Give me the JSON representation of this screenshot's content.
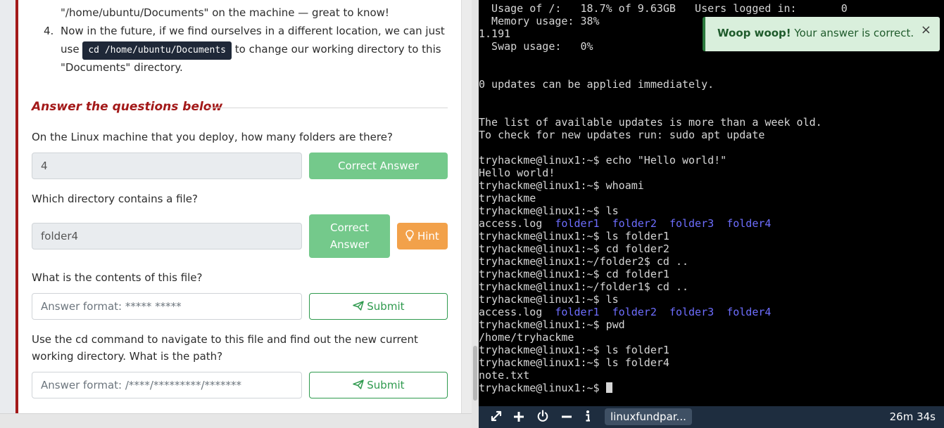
{
  "task": {
    "step3_tail": "\"/home/ubuntu/Documents\" on the machine — great to know!",
    "step4_number": "4.",
    "step4_line1": "Now in the future, if we find ourselves in a different location, we can just",
    "step4_use": "use",
    "step4_code": "cd /home/ubuntu/Documents",
    "step4_after_code": "to change our working directory to this",
    "step4_line3": "\"Documents\" directory."
  },
  "answer_section": {
    "title": "Answer the questions below"
  },
  "questions": [
    {
      "text": "On the Linux machine that you deploy, how many folders are there?",
      "answer_value": "4",
      "button_label": "Correct Answer"
    },
    {
      "text": "Which directory contains a file?",
      "answer_value": "folder4",
      "button_label_line1": "Correct",
      "button_label_line2": "Answer",
      "hint_label": "Hint"
    },
    {
      "text": "What is the contents of this file?",
      "placeholder": "Answer format: ***** *****",
      "button_label": "Submit"
    },
    {
      "text": "Use the cd command to navigate to this file and find out the new current working directory. What is the path?",
      "placeholder": "Answer format: /****/*********/*******",
      "button_label": "Submit"
    }
  ],
  "terminal": {
    "lines": [
      "  Usage of /:   18.7% of 9.63GB   Users logged in:       0",
      "  Memory usage: 38%",
      "1.191",
      "  Swap usage:   0%",
      "",
      "",
      "0 updates can be applied immediately.",
      "",
      "",
      "The list of available updates is more than a week old.",
      "To check for new updates run: sudo apt update",
      "",
      "tryhackme@linux1:~$ echo \"Hello world!\"",
      "Hello world!",
      "tryhackme@linux1:~$ whoami",
      "tryhackme",
      "tryhackme@linux1:~$ ls",
      "",
      "tryhackme@linux1:~$ ls folder1",
      "tryhackme@linux1:~$ cd folder2",
      "tryhackme@linux1:~/folder2$ cd ..",
      "tryhackme@linux1:~$ cd folder1",
      "tryhackme@linux1:~/folder1$ cd ..",
      "tryhackme@linux1:~$ ls",
      "",
      "tryhackme@linux1:~$ pwd",
      "/home/tryhackme",
      "tryhackme@linux1:~$ ls folder1",
      "tryhackme@linux1:~$ ls folder4",
      "note.txt",
      "tryhackme@linux1:~$ "
    ],
    "ls_file": "access.log",
    "ls_dirs": [
      "folder1",
      "folder2",
      "folder3",
      "folder4"
    ]
  },
  "toast": {
    "bold": "Woop woop!",
    "message": " Your answer is correct.",
    "close": "×"
  },
  "taskbar": {
    "tab_label": "linuxfundpar...",
    "timer": "26m 34s"
  },
  "colors": {
    "accent_red": "#a31919",
    "correct_green": "#74c98b",
    "submit_green": "#2f9a4e",
    "hint_orange": "#f2a14a",
    "terminal_dir_blue": "#6e6eff"
  },
  "icons": [
    "fullscreen-icon",
    "plus-icon",
    "power-icon",
    "minus-icon",
    "info-icon",
    "lightbulb-icon",
    "paper-plane-icon"
  ]
}
